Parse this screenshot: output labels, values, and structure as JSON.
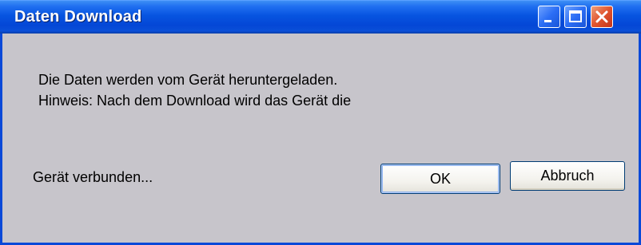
{
  "window": {
    "title": "Daten Download",
    "controls": {
      "minimize": "minimize-icon",
      "maximize": "maximize-icon",
      "close": "close-icon"
    }
  },
  "dialog": {
    "message_line1": "Die Daten werden vom Gerät heruntergeladen.",
    "message_line2": "Hinweis: Nach dem Download wird das Gerät die",
    "status": "Gerät verbunden...",
    "ok_label": "OK",
    "cancel_label": "Abbruch"
  },
  "colors": {
    "titlebar": "#0754e0",
    "client_background": "#c7c5cb",
    "close_button": "#e0542e"
  }
}
